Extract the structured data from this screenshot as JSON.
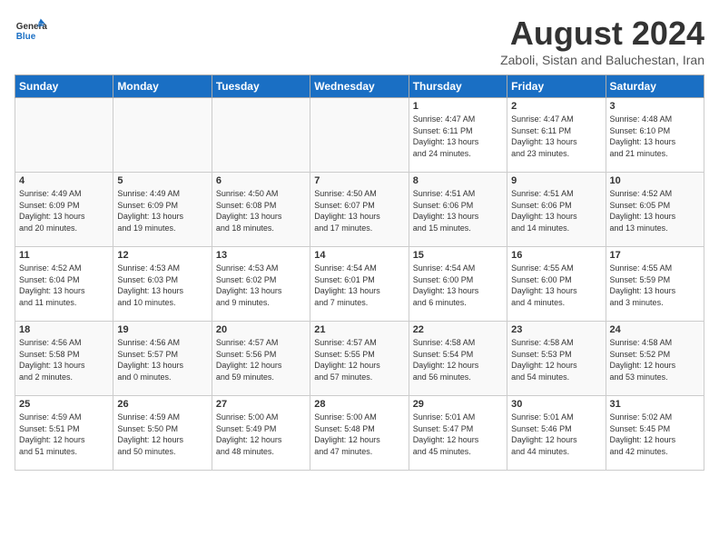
{
  "header": {
    "logo_general": "General",
    "logo_blue": "Blue",
    "month": "August 2024",
    "location": "Zaboli, Sistan and Baluchestan, Iran"
  },
  "weekdays": [
    "Sunday",
    "Monday",
    "Tuesday",
    "Wednesday",
    "Thursday",
    "Friday",
    "Saturday"
  ],
  "weeks": [
    [
      {
        "day": "",
        "info": ""
      },
      {
        "day": "",
        "info": ""
      },
      {
        "day": "",
        "info": ""
      },
      {
        "day": "",
        "info": ""
      },
      {
        "day": "1",
        "info": "Sunrise: 4:47 AM\nSunset: 6:11 PM\nDaylight: 13 hours\nand 24 minutes."
      },
      {
        "day": "2",
        "info": "Sunrise: 4:47 AM\nSunset: 6:11 PM\nDaylight: 13 hours\nand 23 minutes."
      },
      {
        "day": "3",
        "info": "Sunrise: 4:48 AM\nSunset: 6:10 PM\nDaylight: 13 hours\nand 21 minutes."
      }
    ],
    [
      {
        "day": "4",
        "info": "Sunrise: 4:49 AM\nSunset: 6:09 PM\nDaylight: 13 hours\nand 20 minutes."
      },
      {
        "day": "5",
        "info": "Sunrise: 4:49 AM\nSunset: 6:09 PM\nDaylight: 13 hours\nand 19 minutes."
      },
      {
        "day": "6",
        "info": "Sunrise: 4:50 AM\nSunset: 6:08 PM\nDaylight: 13 hours\nand 18 minutes."
      },
      {
        "day": "7",
        "info": "Sunrise: 4:50 AM\nSunset: 6:07 PM\nDaylight: 13 hours\nand 17 minutes."
      },
      {
        "day": "8",
        "info": "Sunrise: 4:51 AM\nSunset: 6:06 PM\nDaylight: 13 hours\nand 15 minutes."
      },
      {
        "day": "9",
        "info": "Sunrise: 4:51 AM\nSunset: 6:06 PM\nDaylight: 13 hours\nand 14 minutes."
      },
      {
        "day": "10",
        "info": "Sunrise: 4:52 AM\nSunset: 6:05 PM\nDaylight: 13 hours\nand 13 minutes."
      }
    ],
    [
      {
        "day": "11",
        "info": "Sunrise: 4:52 AM\nSunset: 6:04 PM\nDaylight: 13 hours\nand 11 minutes."
      },
      {
        "day": "12",
        "info": "Sunrise: 4:53 AM\nSunset: 6:03 PM\nDaylight: 13 hours\nand 10 minutes."
      },
      {
        "day": "13",
        "info": "Sunrise: 4:53 AM\nSunset: 6:02 PM\nDaylight: 13 hours\nand 9 minutes."
      },
      {
        "day": "14",
        "info": "Sunrise: 4:54 AM\nSunset: 6:01 PM\nDaylight: 13 hours\nand 7 minutes."
      },
      {
        "day": "15",
        "info": "Sunrise: 4:54 AM\nSunset: 6:00 PM\nDaylight: 13 hours\nand 6 minutes."
      },
      {
        "day": "16",
        "info": "Sunrise: 4:55 AM\nSunset: 6:00 PM\nDaylight: 13 hours\nand 4 minutes."
      },
      {
        "day": "17",
        "info": "Sunrise: 4:55 AM\nSunset: 5:59 PM\nDaylight: 13 hours\nand 3 minutes."
      }
    ],
    [
      {
        "day": "18",
        "info": "Sunrise: 4:56 AM\nSunset: 5:58 PM\nDaylight: 13 hours\nand 2 minutes."
      },
      {
        "day": "19",
        "info": "Sunrise: 4:56 AM\nSunset: 5:57 PM\nDaylight: 13 hours\nand 0 minutes."
      },
      {
        "day": "20",
        "info": "Sunrise: 4:57 AM\nSunset: 5:56 PM\nDaylight: 12 hours\nand 59 minutes."
      },
      {
        "day": "21",
        "info": "Sunrise: 4:57 AM\nSunset: 5:55 PM\nDaylight: 12 hours\nand 57 minutes."
      },
      {
        "day": "22",
        "info": "Sunrise: 4:58 AM\nSunset: 5:54 PM\nDaylight: 12 hours\nand 56 minutes."
      },
      {
        "day": "23",
        "info": "Sunrise: 4:58 AM\nSunset: 5:53 PM\nDaylight: 12 hours\nand 54 minutes."
      },
      {
        "day": "24",
        "info": "Sunrise: 4:58 AM\nSunset: 5:52 PM\nDaylight: 12 hours\nand 53 minutes."
      }
    ],
    [
      {
        "day": "25",
        "info": "Sunrise: 4:59 AM\nSunset: 5:51 PM\nDaylight: 12 hours\nand 51 minutes."
      },
      {
        "day": "26",
        "info": "Sunrise: 4:59 AM\nSunset: 5:50 PM\nDaylight: 12 hours\nand 50 minutes."
      },
      {
        "day": "27",
        "info": "Sunrise: 5:00 AM\nSunset: 5:49 PM\nDaylight: 12 hours\nand 48 minutes."
      },
      {
        "day": "28",
        "info": "Sunrise: 5:00 AM\nSunset: 5:48 PM\nDaylight: 12 hours\nand 47 minutes."
      },
      {
        "day": "29",
        "info": "Sunrise: 5:01 AM\nSunset: 5:47 PM\nDaylight: 12 hours\nand 45 minutes."
      },
      {
        "day": "30",
        "info": "Sunrise: 5:01 AM\nSunset: 5:46 PM\nDaylight: 12 hours\nand 44 minutes."
      },
      {
        "day": "31",
        "info": "Sunrise: 5:02 AM\nSunset: 5:45 PM\nDaylight: 12 hours\nand 42 minutes."
      }
    ]
  ]
}
